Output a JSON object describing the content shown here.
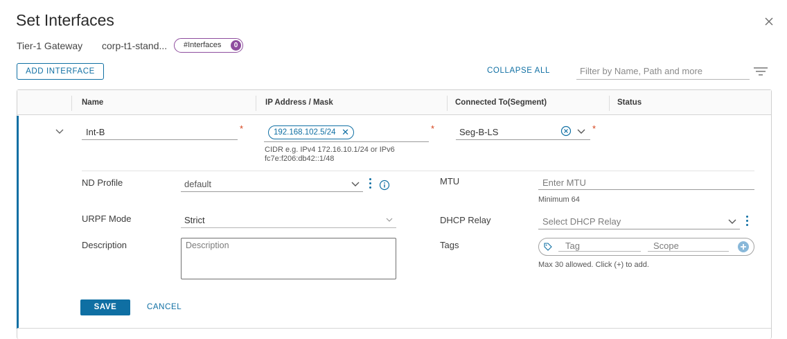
{
  "dialog": {
    "title": "Set Interfaces",
    "close_icon": "close-icon"
  },
  "context": {
    "gateway_type": "Tier-1 Gateway",
    "gateway_name": "corp-t1-stand...",
    "interfaces_badge_label": "#Interfaces",
    "interfaces_count": "0",
    "badge_color": "#8e4d9e"
  },
  "toolbar": {
    "add_interface_label": "ADD INTERFACE",
    "collapse_all_label": "COLLAPSE ALL",
    "filter_placeholder": "Filter by Name, Path and more",
    "filter_icon": "filter-icon"
  },
  "table": {
    "columns": [
      "Name",
      "IP Address / Mask",
      "Connected To(Segment)",
      "Status"
    ]
  },
  "row": {
    "name_value": "Int-B",
    "ip_chip": "192.168.102.5/24",
    "ip_hint": "CIDR e.g. IPv4 172.16.10.1/24 or IPv6 fc7e:f206:db42::1/48",
    "segment_value": "Seg-B-LS",
    "required_mark": "*"
  },
  "form": {
    "nd_profile_label": "ND Profile",
    "nd_profile_value": "default",
    "mtu_label": "MTU",
    "mtu_placeholder": "Enter MTU",
    "mtu_hint": "Minimum 64",
    "urpf_label": "URPF Mode",
    "urpf_value": "Strict",
    "dhcp_relay_label": "DHCP Relay",
    "dhcp_relay_placeholder": "Select DHCP Relay",
    "description_label": "Description",
    "description_placeholder": "Description",
    "tags_label": "Tags",
    "tag_placeholder": "Tag",
    "scope_placeholder": "Scope",
    "tags_hint": "Max 30 allowed. Click (+) to add."
  },
  "actions": {
    "save_label": "SAVE",
    "cancel_label": "CANCEL"
  },
  "colors": {
    "primary": "#0f6fa3",
    "required": "#d6431c"
  }
}
